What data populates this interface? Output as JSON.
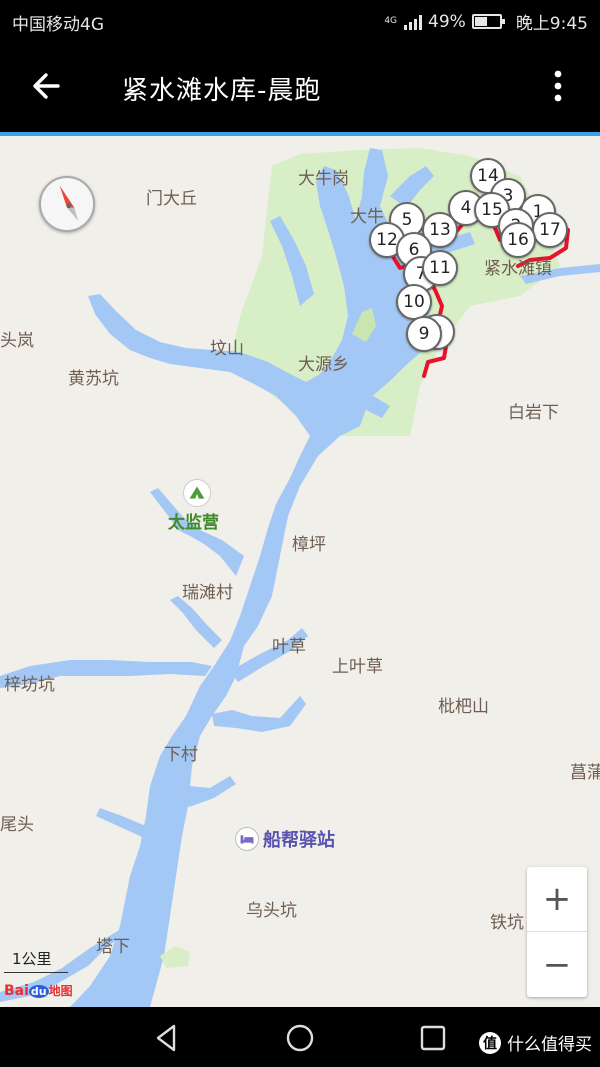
{
  "status_bar": {
    "carrier": "中国移动4G",
    "network": "4G",
    "battery": "49%",
    "battery_level": 0.49,
    "time": "晚上9:45"
  },
  "app_bar": {
    "title": "紧水滩水库-晨跑"
  },
  "map": {
    "places": [
      {
        "name": "大牛岗",
        "color": "brown"
      },
      {
        "name": "门大丘",
        "color": "brown"
      },
      {
        "name": "大牛",
        "color": "brown"
      },
      {
        "name": "紧水滩镇",
        "color": "brown"
      },
      {
        "name": "头岚",
        "color": "brown"
      },
      {
        "name": "坟山",
        "color": "brown"
      },
      {
        "name": "大源乡",
        "color": "brown"
      },
      {
        "name": "黄苏坑",
        "color": "brown"
      },
      {
        "name": "白岩下",
        "color": "brown"
      },
      {
        "name": "太监营",
        "color": "green"
      },
      {
        "name": "樟坪",
        "color": "brown"
      },
      {
        "name": "瑞滩村",
        "color": "brown"
      },
      {
        "name": "叶草",
        "color": "brown"
      },
      {
        "name": "上叶草",
        "color": "brown"
      },
      {
        "name": "梓坊坑",
        "color": "brown"
      },
      {
        "name": "枇杷山",
        "color": "brown"
      },
      {
        "name": "下村",
        "color": "brown"
      },
      {
        "name": "菖蒲",
        "color": "brown"
      },
      {
        "name": "尾头",
        "color": "brown"
      },
      {
        "name": "船帮驿站",
        "color": "poi"
      },
      {
        "name": "乌头坑",
        "color": "brown"
      },
      {
        "name": "铁坑",
        "color": "brown"
      },
      {
        "name": "塔下",
        "color": "brown"
      }
    ],
    "waypoints": [
      "14",
      "3",
      "1",
      "4",
      "15",
      "2",
      "17",
      "5",
      "13",
      "16",
      "12",
      "6",
      "7",
      "11",
      "10",
      "8",
      "9"
    ],
    "scale_label": "1公里",
    "logo_text": "Bai",
    "logo_text_2": "du",
    "logo_text_3": "地图",
    "zoom_in": "+",
    "zoom_out": "−",
    "colors": {
      "water": "#a3c8f5",
      "park": "#d7eec6",
      "land": "#f1efe9",
      "route": "#e8132b",
      "accent": "#3aa0e8"
    }
  },
  "watermark": {
    "icon": "值",
    "text": "什么值得买"
  }
}
